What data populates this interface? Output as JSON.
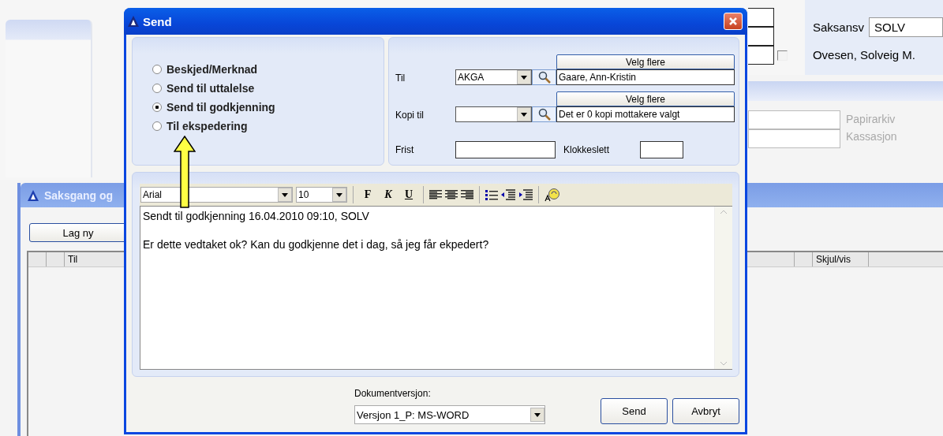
{
  "background_window": {
    "saksansv_label": "Saksansv",
    "saksansv_value": "SOLV",
    "owner_name": "Ovesen, Solveig M.",
    "checkbox_checked": false,
    "archive_labels": [
      "Papirarkiv",
      "Kassasjon"
    ]
  },
  "saksgang_window": {
    "title": "Saksgang og",
    "new_button": "Lag ny",
    "columns": [
      {
        "label": "Til"
      },
      {
        "label": "Skjul/vis"
      }
    ]
  },
  "dialog": {
    "title": "Send",
    "send_types": [
      {
        "label": "Beskjed/Merknad",
        "selected": false
      },
      {
        "label": "Send til uttalelse",
        "selected": false
      },
      {
        "label": "Send til godkjenning",
        "selected": true
      },
      {
        "label": "Til ekspedering",
        "selected": false
      }
    ],
    "recipient": {
      "label": "Til",
      "code": "AKGA",
      "choose_button": "Velg flere",
      "name": "Gaare, Ann-Kristin"
    },
    "copy": {
      "label": "Kopi til",
      "choose_button": "Velg flere",
      "name": "Det er 0 kopi mottakere valgt"
    },
    "deadline": {
      "label": "Frist",
      "time_label": "Klokkeslett"
    },
    "editor": {
      "font": "Arial",
      "size": "10",
      "format_buttons": [
        "F",
        "K",
        "U"
      ],
      "lines": [
        "Sendt til godkjenning 16.04.2010 09:10, SOLV",
        "Er dette vedtaket ok? Kan du godkjenne det i dag, så jeg får ekpedert?"
      ]
    },
    "version_label": "Dokumentversjon:",
    "version_value": "Versjon 1_P: MS-WORD",
    "buttons": [
      "Send",
      "Avbryt"
    ]
  }
}
